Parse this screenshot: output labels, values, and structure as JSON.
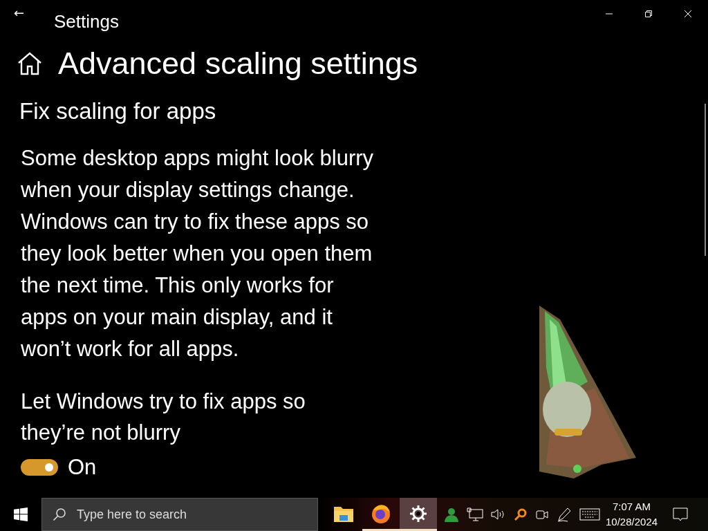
{
  "window": {
    "title": "Settings",
    "back": "←"
  },
  "page": {
    "title": "Advanced scaling settings"
  },
  "section": {
    "heading": "Fix scaling for apps",
    "description": "Some desktop apps might look blurry when your display settings change. Windows can try to fix these apps so they look better when you open them the next time. This only works for apps on your main display, and it won’t work for all apps.",
    "setting_label": "Let Windows try to fix apps so they’re not blurry",
    "toggle": {
      "on": true,
      "label": "On"
    }
  },
  "taskbar": {
    "search": {
      "placeholder": "Type here to search"
    },
    "apps": [
      {
        "kind": "explorer",
        "running": false,
        "selected": false
      },
      {
        "kind": "browser",
        "running": true,
        "selected": false
      },
      {
        "kind": "settings",
        "running": true,
        "selected": true
      }
    ],
    "tray": [
      {
        "kind": "person"
      },
      {
        "kind": "network"
      },
      {
        "kind": "volume"
      },
      {
        "kind": "search"
      },
      {
        "kind": "camera"
      },
      {
        "kind": "pen"
      },
      {
        "kind": "keyboard"
      }
    ],
    "time": "7:07 AM",
    "date": "10/28/2024"
  }
}
